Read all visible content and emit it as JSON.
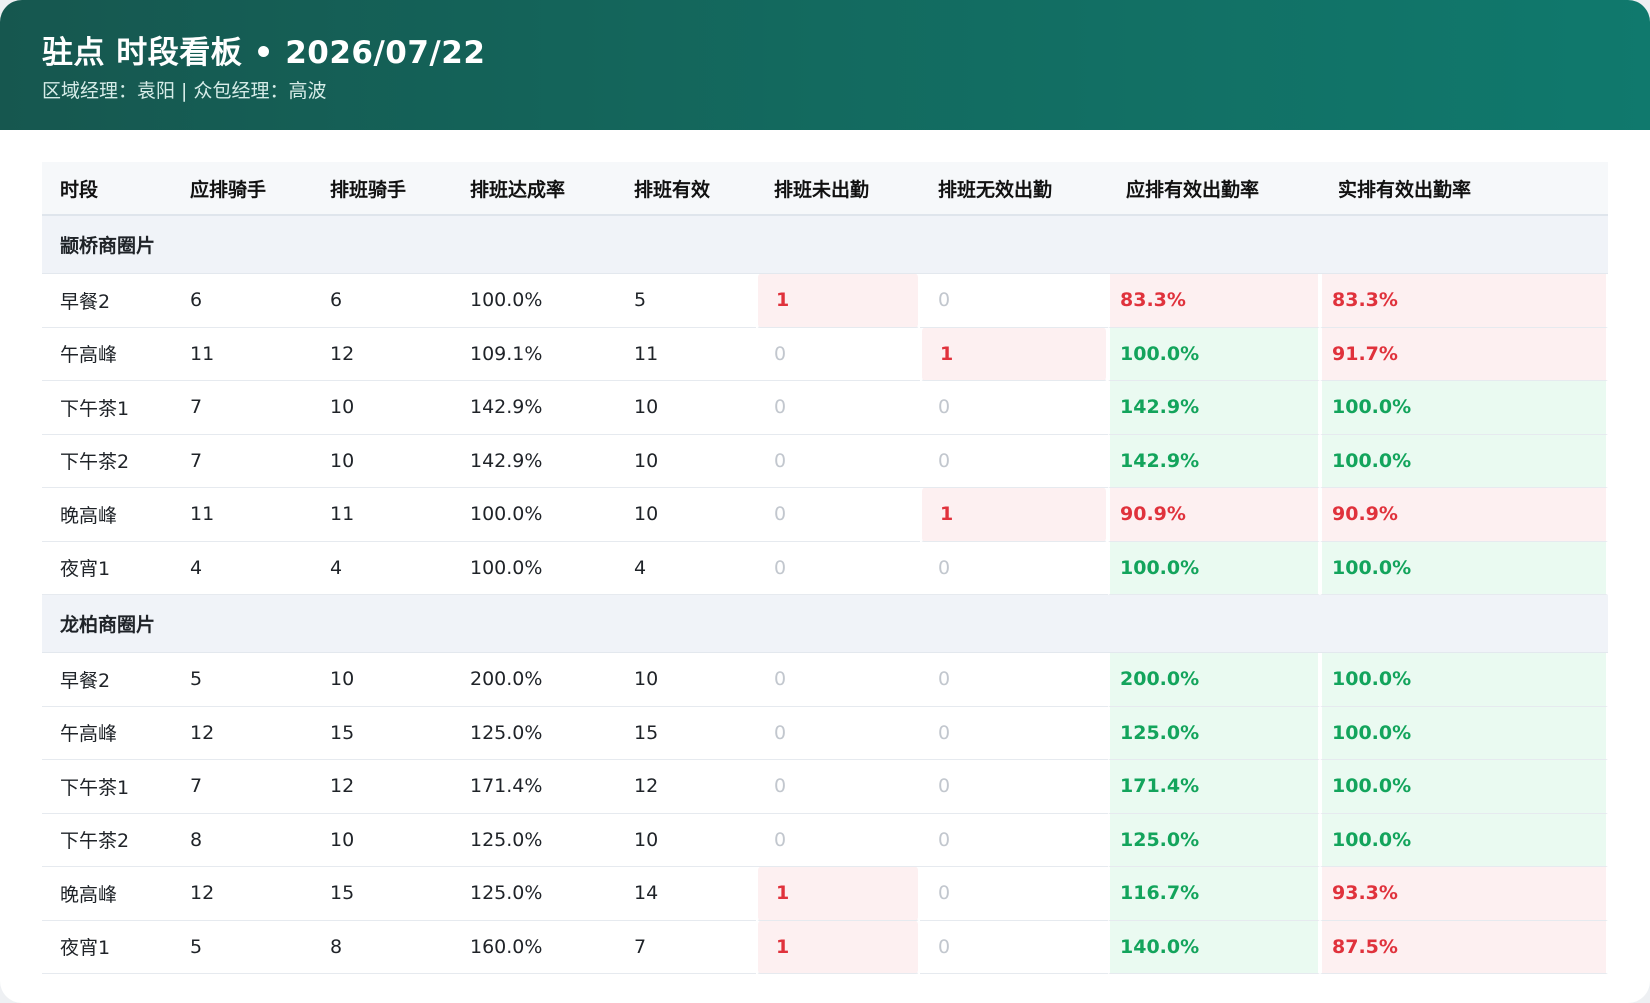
{
  "header": {
    "title": "驻点 时段看板 • 2026/07/22",
    "subtitle": "区域经理：袁阳 | 众包经理：高波",
    "gradient_start": "#16574f",
    "gradient_end": "#10796d"
  },
  "table": {
    "columns": [
      "时段",
      "应排骑手",
      "排班骑手",
      "排班达成率",
      "排班有效",
      "排班未出勤",
      "排班无效出勤",
      "应排有效出勤率",
      "实排有效出勤率"
    ],
    "groups": [
      {
        "name": "颛桥商圈片",
        "rows": [
          {
            "slot": "早餐2",
            "required": "6",
            "scheduled": "6",
            "fill_rate": "100.0%",
            "valid": "5",
            "absent": "1",
            "invalid": "0",
            "req_rate": "83.3%",
            "act_rate": "83.3%"
          },
          {
            "slot": "午高峰",
            "required": "11",
            "scheduled": "12",
            "fill_rate": "109.1%",
            "valid": "11",
            "absent": "0",
            "invalid": "1",
            "req_rate": "100.0%",
            "act_rate": "91.7%"
          },
          {
            "slot": "下午茶1",
            "required": "7",
            "scheduled": "10",
            "fill_rate": "142.9%",
            "valid": "10",
            "absent": "0",
            "invalid": "0",
            "req_rate": "142.9%",
            "act_rate": "100.0%"
          },
          {
            "slot": "下午茶2",
            "required": "7",
            "scheduled": "10",
            "fill_rate": "142.9%",
            "valid": "10",
            "absent": "0",
            "invalid": "0",
            "req_rate": "142.9%",
            "act_rate": "100.0%"
          },
          {
            "slot": "晚高峰",
            "required": "11",
            "scheduled": "11",
            "fill_rate": "100.0%",
            "valid": "10",
            "absent": "0",
            "invalid": "1",
            "req_rate": "90.9%",
            "act_rate": "90.9%"
          },
          {
            "slot": "夜宵1",
            "required": "4",
            "scheduled": "4",
            "fill_rate": "100.0%",
            "valid": "4",
            "absent": "0",
            "invalid": "0",
            "req_rate": "100.0%",
            "act_rate": "100.0%"
          }
        ]
      },
      {
        "name": "龙柏商圈片",
        "rows": [
          {
            "slot": "早餐2",
            "required": "5",
            "scheduled": "10",
            "fill_rate": "200.0%",
            "valid": "10",
            "absent": "0",
            "invalid": "0",
            "req_rate": "200.0%",
            "act_rate": "100.0%"
          },
          {
            "slot": "午高峰",
            "required": "12",
            "scheduled": "15",
            "fill_rate": "125.0%",
            "valid": "15",
            "absent": "0",
            "invalid": "0",
            "req_rate": "125.0%",
            "act_rate": "100.0%"
          },
          {
            "slot": "下午茶1",
            "required": "7",
            "scheduled": "12",
            "fill_rate": "171.4%",
            "valid": "12",
            "absent": "0",
            "invalid": "0",
            "req_rate": "171.4%",
            "act_rate": "100.0%"
          },
          {
            "slot": "下午茶2",
            "required": "8",
            "scheduled": "10",
            "fill_rate": "125.0%",
            "valid": "10",
            "absent": "0",
            "invalid": "0",
            "req_rate": "125.0%",
            "act_rate": "100.0%"
          },
          {
            "slot": "晚高峰",
            "required": "12",
            "scheduled": "15",
            "fill_rate": "125.0%",
            "valid": "14",
            "absent": "1",
            "invalid": "0",
            "req_rate": "116.7%",
            "act_rate": "93.3%"
          },
          {
            "slot": "夜宵1",
            "required": "5",
            "scheduled": "8",
            "fill_rate": "160.0%",
            "valid": "7",
            "absent": "1",
            "invalid": "0",
            "req_rate": "140.0%",
            "act_rate": "87.5%"
          }
        ]
      }
    ]
  },
  "colors": {
    "good": "#13a45c",
    "bad": "#e0323c",
    "zero": "#c2c7ce"
  }
}
